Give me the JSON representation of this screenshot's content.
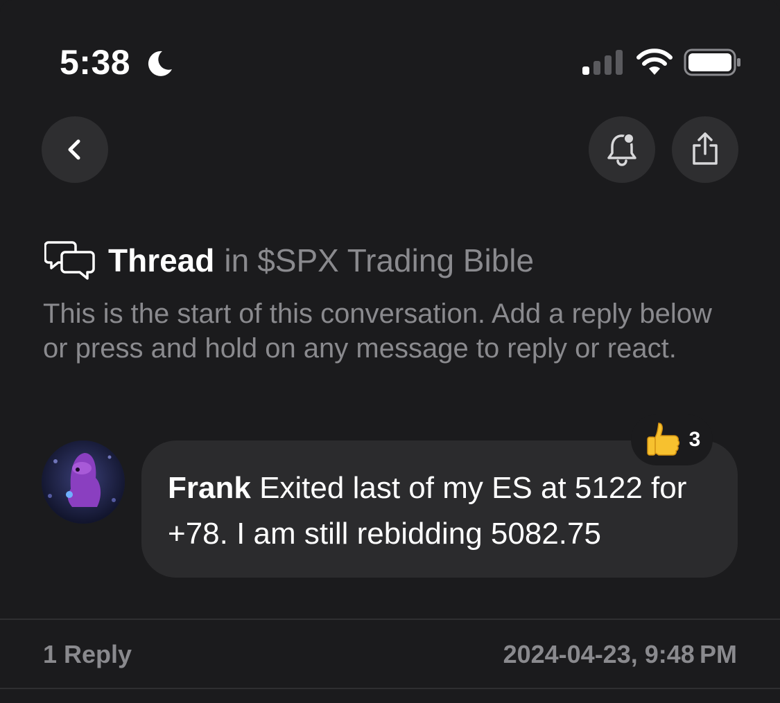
{
  "status_bar": {
    "time": "5:38",
    "icons": [
      "moon-icon",
      "cellular-signal-icon",
      "wifi-icon",
      "battery-icon"
    ]
  },
  "nav": {
    "back_icon": "chevron-left-icon",
    "notify_icon": "bell-icon",
    "share_icon": "share-icon"
  },
  "thread": {
    "title": "Thread",
    "in": "in",
    "channel": "$SPX Trading Bible",
    "intro": "This is the start of this conversation. Add a reply below or press and hold on any message to reply or react."
  },
  "message": {
    "author": "Frank",
    "text": "Exited last of my ES at 5122 for +78. I am still rebidding 5082.75",
    "reaction": {
      "emoji": "thumbs-up",
      "count": "3"
    }
  },
  "footer": {
    "reply_count": "1 Reply",
    "timestamp": "2024-04-23, 9:48 PM"
  },
  "colors": {
    "background": "#1b1b1d",
    "bubble": "#2b2b2d",
    "button": "#2e2e30",
    "muted_text": "#8a8a8e",
    "text": "#ffffff"
  }
}
